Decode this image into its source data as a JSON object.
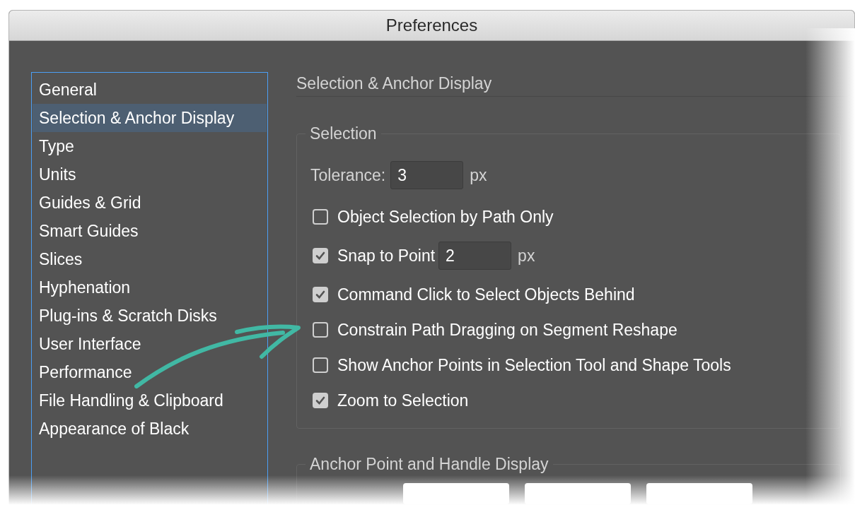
{
  "window": {
    "title": "Preferences"
  },
  "sidebar": {
    "items": [
      {
        "label": "General",
        "selected": false
      },
      {
        "label": "Selection & Anchor Display",
        "selected": true
      },
      {
        "label": "Type",
        "selected": false
      },
      {
        "label": "Units",
        "selected": false
      },
      {
        "label": "Guides & Grid",
        "selected": false
      },
      {
        "label": "Smart Guides",
        "selected": false
      },
      {
        "label": "Slices",
        "selected": false
      },
      {
        "label": "Hyphenation",
        "selected": false
      },
      {
        "label": "Plug-ins & Scratch Disks",
        "selected": false
      },
      {
        "label": "User Interface",
        "selected": false
      },
      {
        "label": "Performance",
        "selected": false
      },
      {
        "label": "File Handling & Clipboard",
        "selected": false
      },
      {
        "label": "Appearance of Black",
        "selected": false
      }
    ]
  },
  "panel": {
    "title": "Selection & Anchor Display",
    "selection": {
      "legend": "Selection",
      "tolerance": {
        "label": "Tolerance:",
        "value": "3",
        "unit": "px"
      },
      "options": [
        {
          "kind": "checkbox",
          "label": "Object Selection by Path Only",
          "checked": false
        },
        {
          "kind": "checkbox-field",
          "label": "Snap to Point",
          "checked": true,
          "value": "2",
          "unit": "px"
        },
        {
          "kind": "checkbox",
          "label": "Command Click to Select Objects Behind",
          "checked": true
        },
        {
          "kind": "checkbox",
          "label": "Constrain Path Dragging on Segment Reshape",
          "checked": false
        },
        {
          "kind": "checkbox",
          "label": "Show Anchor Points in Selection Tool and Shape Tools",
          "checked": false
        },
        {
          "kind": "checkbox",
          "label": "Zoom to Selection",
          "checked": true
        }
      ]
    },
    "anchor_display": {
      "legend": "Anchor Point and Handle Display"
    }
  }
}
